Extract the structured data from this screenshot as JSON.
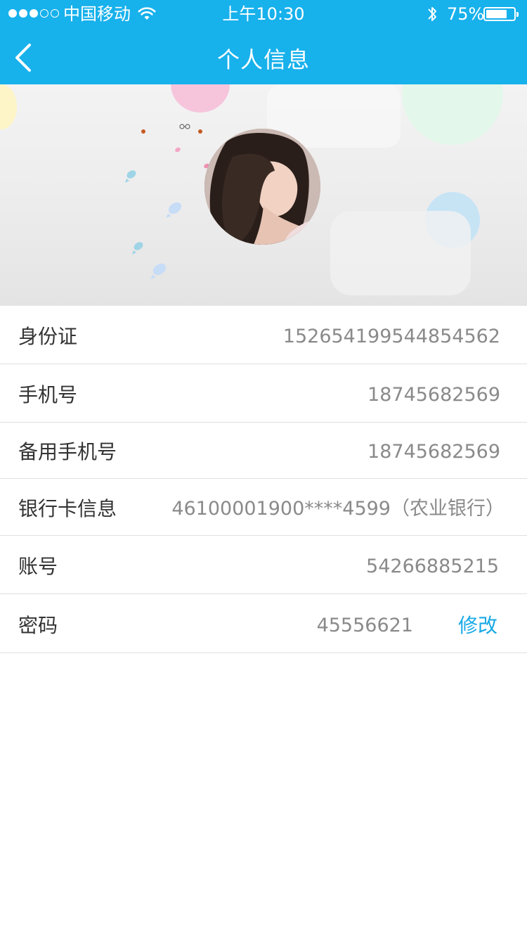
{
  "status_bar": {
    "carrier": "中国移动",
    "time": "上午10:30",
    "battery_percent": "75%",
    "battery_level": 0.75,
    "signal_bars": 3,
    "signal_total": 5
  },
  "nav": {
    "title": "个人信息",
    "back_icon": "chevron-left-icon"
  },
  "colors": {
    "primary": "#17b1ec",
    "link": "#17a9e6",
    "label": "#333333",
    "value": "#8a8a8a"
  },
  "profile": {
    "avatar_icon": "user-avatar-photo"
  },
  "info_rows": [
    {
      "label": "身份证",
      "value": "152654199544854562"
    },
    {
      "label": "手机号",
      "value": "18745682569"
    },
    {
      "label": "备用手机号",
      "value": "18745682569"
    },
    {
      "label": "银行卡信息",
      "value": "46100001900****4599（农业银行）"
    },
    {
      "label": "账号",
      "value": "54266885215"
    },
    {
      "label": "密码",
      "value": "45556621",
      "action": "修改"
    }
  ]
}
